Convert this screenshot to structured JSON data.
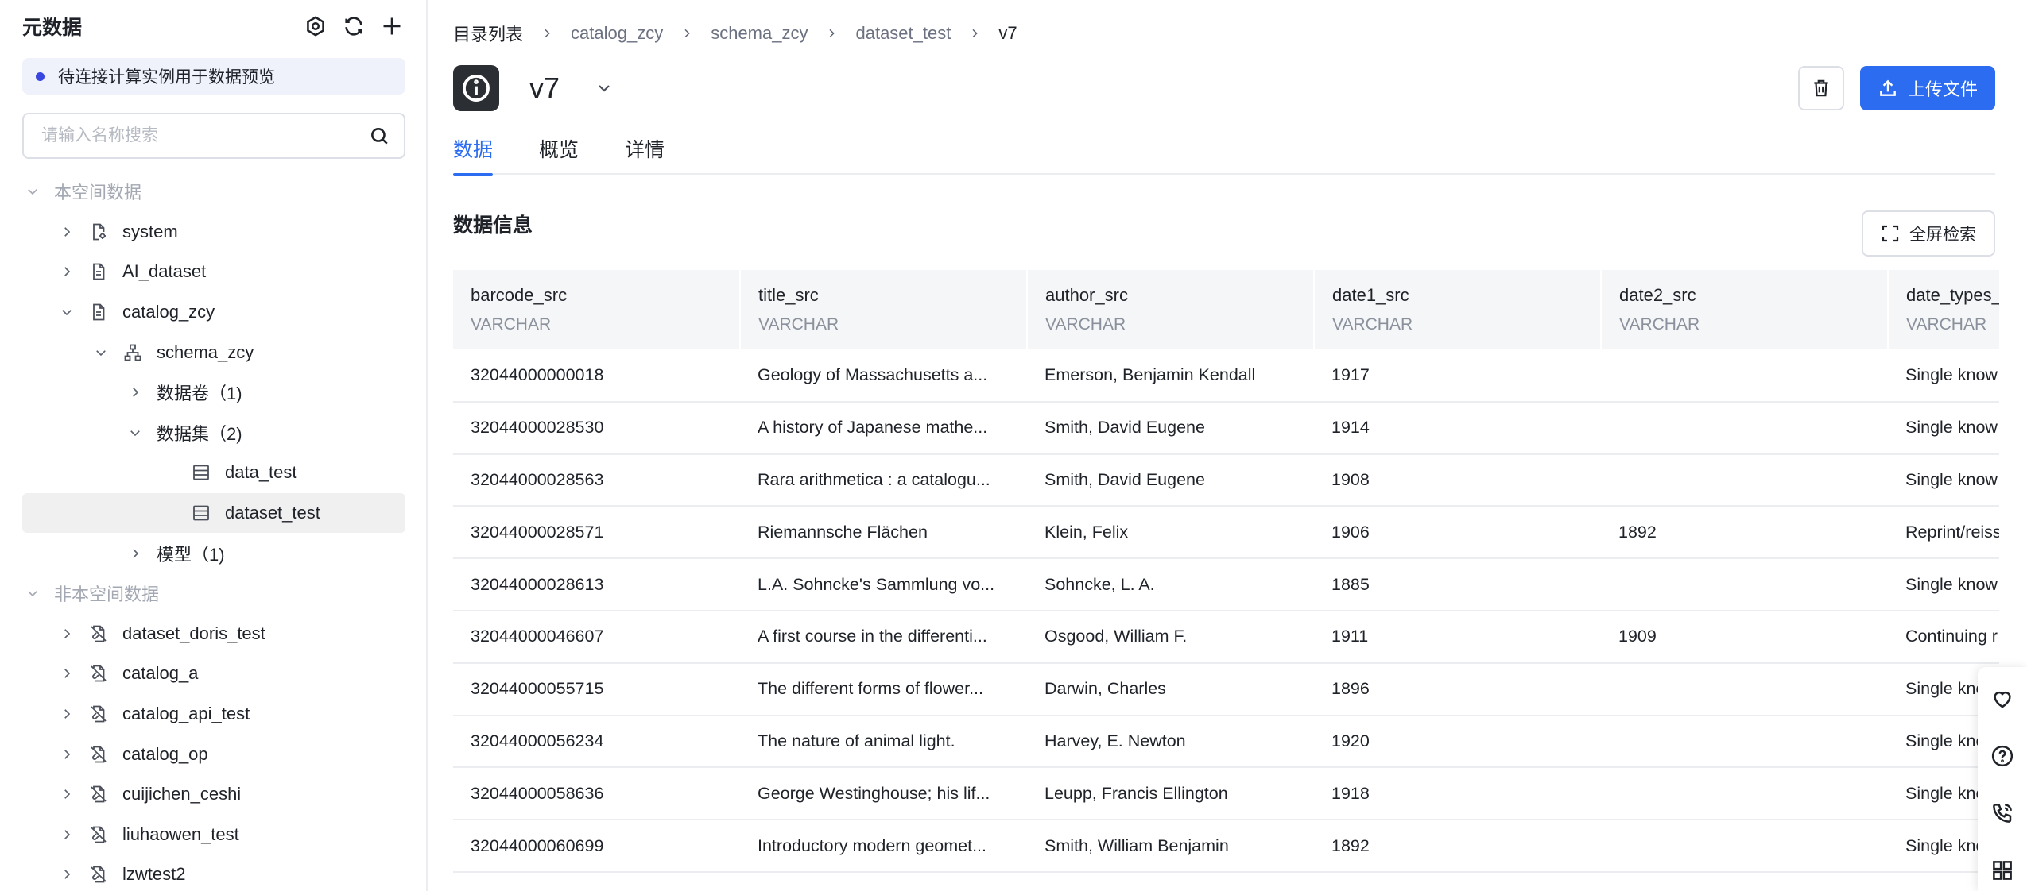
{
  "sidebar": {
    "title": "元数据",
    "notice": "待连接计算实例用于数据预览",
    "search_placeholder": "请输入名称搜索",
    "tree": [
      {
        "label": "本空间数据",
        "level": 0,
        "state": "open",
        "icon": "none",
        "group": true
      },
      {
        "label": "system",
        "level": 1,
        "state": "closed",
        "icon": "doc-gear-icon"
      },
      {
        "label": "AI_dataset",
        "level": 1,
        "state": "closed",
        "icon": "doc-icon"
      },
      {
        "label": "catalog_zcy",
        "level": 1,
        "state": "open",
        "icon": "doc-icon"
      },
      {
        "label": "schema_zcy",
        "level": 2,
        "state": "open",
        "icon": "hierarchy-icon"
      },
      {
        "label": "数据卷（1)",
        "level": 3,
        "state": "closed",
        "icon": "none"
      },
      {
        "label": "数据集（2)",
        "level": 3,
        "state": "open",
        "icon": "none"
      },
      {
        "label": "data_test",
        "level": 4,
        "state": "leaf",
        "icon": "table-icon"
      },
      {
        "label": "dataset_test",
        "level": 4,
        "state": "leaf",
        "icon": "table-icon",
        "selected": true
      },
      {
        "label": "模型（1)",
        "level": 3,
        "state": "closed",
        "icon": "none"
      },
      {
        "label": "非本空间数据",
        "level": 0,
        "state": "open",
        "icon": "none",
        "group": true
      },
      {
        "label": "dataset_doris_test",
        "level": 1,
        "state": "closed",
        "icon": "doc-link-off-icon"
      },
      {
        "label": "catalog_a",
        "level": 1,
        "state": "closed",
        "icon": "doc-link-off-icon"
      },
      {
        "label": "catalog_api_test",
        "level": 1,
        "state": "closed",
        "icon": "doc-link-off-icon"
      },
      {
        "label": "catalog_op",
        "level": 1,
        "state": "closed",
        "icon": "doc-link-off-icon"
      },
      {
        "label": "cuijichen_ceshi",
        "level": 1,
        "state": "closed",
        "icon": "doc-link-off-icon"
      },
      {
        "label": "liuhaowen_test",
        "level": 1,
        "state": "closed",
        "icon": "doc-link-off-icon"
      },
      {
        "label": "lzwtest2",
        "level": 1,
        "state": "closed",
        "icon": "doc-link-off-icon"
      }
    ]
  },
  "breadcrumb": [
    "目录列表",
    "catalog_zcy",
    "schema_zcy",
    "dataset_test",
    "v7"
  ],
  "header": {
    "title": "v7",
    "upload_label": "上传文件"
  },
  "tabs": [
    {
      "label": "数据",
      "active": true
    },
    {
      "label": "概览",
      "active": false
    },
    {
      "label": "详情",
      "active": false
    }
  ],
  "section": {
    "title": "数据信息",
    "fullscreen_label": "全屏检索"
  },
  "table": {
    "columns": [
      {
        "name": "barcode_src",
        "type": "VARCHAR"
      },
      {
        "name": "title_src",
        "type": "VARCHAR"
      },
      {
        "name": "author_src",
        "type": "VARCHAR"
      },
      {
        "name": "date1_src",
        "type": "VARCHAR"
      },
      {
        "name": "date2_src",
        "type": "VARCHAR"
      },
      {
        "name": "date_types_",
        "type": "VARCHAR"
      }
    ],
    "rows": [
      [
        "32044000000018",
        "Geology of Massachusetts a...",
        "Emerson, Benjamin Kendall",
        "1917",
        "",
        "Single know"
      ],
      [
        "32044000028530",
        "A history of Japanese mathe...",
        "Smith, David Eugene",
        "1914",
        "",
        "Single know"
      ],
      [
        "32044000028563",
        "Rara arithmetica : a catalogu...",
        "Smith, David Eugene",
        "1908",
        "",
        "Single know"
      ],
      [
        "32044000028571",
        "Riemannsche Flächen",
        "Klein, Felix",
        "1906",
        "1892",
        "Reprint/reiss"
      ],
      [
        "32044000028613",
        "L.A. Sohncke's Sammlung vo...",
        "Sohncke, L. A.",
        "1885",
        "",
        "Single know"
      ],
      [
        "32044000046607",
        "A first course in the differenti...",
        "Osgood, William F.",
        "1911",
        "1909",
        "Continuing r"
      ],
      [
        "32044000055715",
        "The different forms of flower...",
        "Darwin, Charles",
        "1896",
        "",
        "Single kno"
      ],
      [
        "32044000056234",
        "The nature of animal light.",
        "Harvey, E. Newton",
        "1920",
        "",
        "Single kno"
      ],
      [
        "32044000058636",
        "George Westinghouse; his lif...",
        "Leupp, Francis Ellington",
        "1918",
        "",
        "Single kno"
      ],
      [
        "32044000060699",
        "Introductory modern geomet...",
        "Smith, William Benjamin",
        "1892",
        "",
        "Single kno"
      ]
    ]
  },
  "float_toolbar": [
    "heart-icon",
    "help-icon",
    "phone-icon",
    "apps-icon"
  ]
}
